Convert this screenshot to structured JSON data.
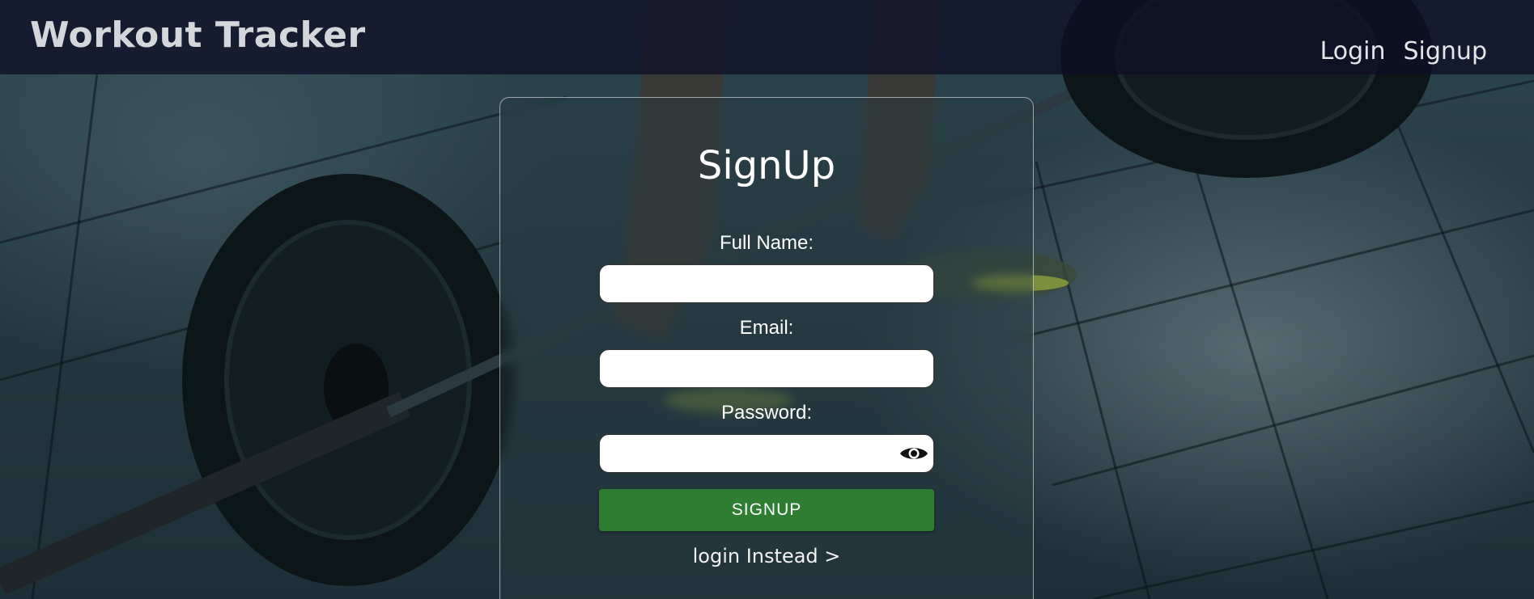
{
  "header": {
    "brand": "Workout Tracker",
    "nav": {
      "login": "Login",
      "signup": "Signup"
    }
  },
  "signup_card": {
    "title": "SignUp",
    "full_name": {
      "label": "Full Name:",
      "value": "",
      "placeholder": ""
    },
    "email": {
      "label": "Email:",
      "value": "",
      "placeholder": ""
    },
    "password": {
      "label": "Password:",
      "value": "",
      "placeholder": "",
      "toggle_icon": "eye-icon"
    },
    "submit_label": "SIGNUP",
    "alt_link": "login Instead >"
  },
  "colors": {
    "header_bg": "#0e1026",
    "button_green": "#2e7d32",
    "text_light": "#ffffff"
  }
}
